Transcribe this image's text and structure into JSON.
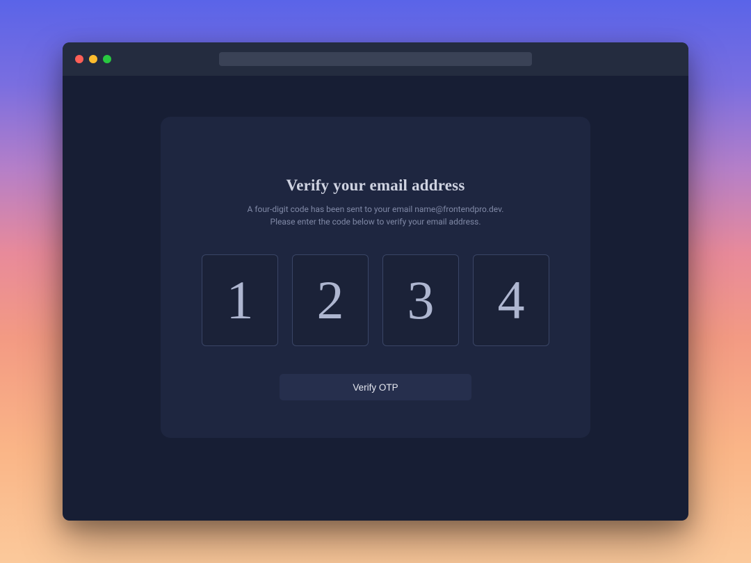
{
  "window": {
    "traffic_lights": [
      "close",
      "minimize",
      "maximize"
    ]
  },
  "card": {
    "title": "Verify your email address",
    "subtitle_line1": "A four-digit code has been sent to your email name@frontendpro.dev.",
    "subtitle_line2": "Please enter the code below to verify your email address.",
    "otp": [
      "1",
      "2",
      "3",
      "4"
    ],
    "button_label": "Verify OTP"
  },
  "colors": {
    "window_bg": "#171e34",
    "titlebar_bg": "#242c3f",
    "card_bg": "#1e2640",
    "text_primary": "#cfd3e1",
    "text_secondary": "#8089a6",
    "otp_text": "#aeb6d0",
    "button_bg": "#262f4d"
  }
}
